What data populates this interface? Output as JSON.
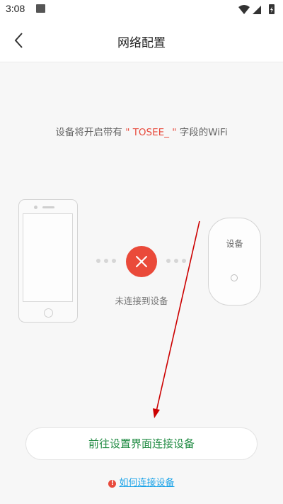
{
  "status_bar": {
    "time": "3:08",
    "icons": [
      "image-icon",
      "wifi-icon",
      "signal-icon",
      "battery-charging-icon"
    ]
  },
  "header": {
    "back_icon": "chevron-left-icon",
    "title": "网络配置"
  },
  "info": {
    "prefix": "设备将开启带有",
    "highlight": "\" TOSEE_ \"",
    "suffix": "字段的WiFi"
  },
  "diagram": {
    "phone_icon": "phone-outline-icon",
    "status_icon": "close-icon",
    "status_label": "未连接到设备",
    "device_label": "设备",
    "colors": {
      "error": "#ea4a3a",
      "outline": "#d4d4d4"
    }
  },
  "actions": {
    "connect_label": "前往设置界面连接设备",
    "help_link": "如何连接设备",
    "help_icon": "exclamation-icon",
    "colors": {
      "connect_text": "#1e8a41",
      "help_link": "#1aa3e8",
      "annotation_arrow": "#cc0000"
    }
  }
}
